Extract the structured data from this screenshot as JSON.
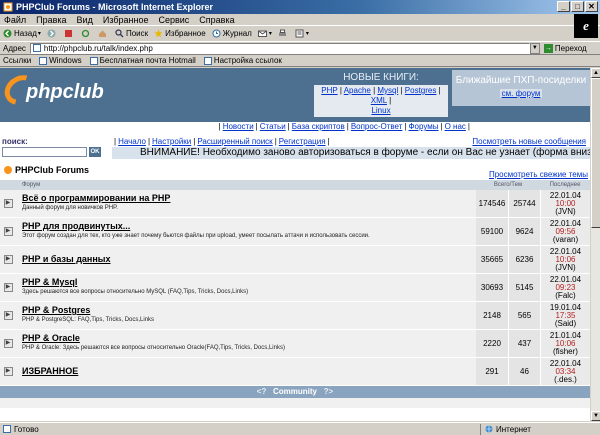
{
  "window": {
    "title": "PHPClub Forums - Microsoft Internet Explorer",
    "min": "_",
    "max": "□",
    "close": "✕"
  },
  "menu": [
    "Файл",
    "Правка",
    "Вид",
    "Избранное",
    "Сервис",
    "Справка"
  ],
  "toolbar": {
    "back": "Назад",
    "search": "Поиск",
    "favorites": "Избранное",
    "history": "Журнал"
  },
  "address": {
    "label": "Адрес",
    "url": "http://phpclub.ru/talk/index.php",
    "go": "Переход"
  },
  "links": {
    "label": "Ссылки",
    "items": [
      "Windows",
      "Бесплатная почта Hotmail",
      "Настройка ссылок"
    ]
  },
  "site": {
    "logo": "phpclub",
    "books_title": "НОВЫЕ КНИГИ:",
    "books_links": [
      "PHP",
      "Apache",
      "Mysql",
      "Postgres",
      "XML",
      "Linux"
    ],
    "meetup_title": "Ближайшие ПХП-посиделки",
    "meetup_link": "см. форум",
    "top_nav": [
      "Новости",
      "Статьи",
      "База скриптов",
      "Вопрос-Ответ",
      "Форумы",
      "О нас"
    ],
    "search_label": "поиск:",
    "search_ok": "OK",
    "sub_nav": [
      "Начало",
      "Настройки",
      "Расширенный поиск",
      "Регистрация"
    ],
    "new_messages": "Посмотреть новые сообщения",
    "alert": "ВНИМАНИЕ! Необходимо заново авторизоваться в форуме - если он Вас не узнает (форма внизу)",
    "forums_title": "PHPClub Forums",
    "fresh_topics": "Просмотреть свежие темы"
  },
  "table": {
    "headers": {
      "forum": "Форум",
      "totals": "Всего/Тем",
      "last": "Последнее"
    },
    "rows": [
      {
        "title": "Всё о программировании на PHP",
        "desc": "Данный форум для новичков PHP.",
        "posts": "174546",
        "topics": "25744",
        "date": "22.01.04",
        "time": "10:00",
        "user": "(JVN)"
      },
      {
        "title": "PHP для продвинутых...",
        "desc": "Этот форум создан для тех, кто уже знает почему бьются файлы при upload, умеет посылать аттачи и использовать сессии.",
        "posts": "59100",
        "topics": "9624",
        "date": "22.01.04",
        "time": "09:56",
        "user": "(varan)"
      },
      {
        "title": "PHP и базы данных",
        "desc": "",
        "posts": "35665",
        "topics": "6236",
        "date": "22.01.04",
        "time": "10:06",
        "user": "(JVN)"
      },
      {
        "title": "PHP & Mysql",
        "desc": "Здесь решаются все вопросы относительно MySQL (FAQ,Tips, Tricks, Docs,Links)",
        "posts": "30693",
        "topics": "5145",
        "date": "22.01.04",
        "time": "09:23",
        "user": "(Falc)"
      },
      {
        "title": "PHP & Postgres",
        "desc": "PHP & PostgreSQL: FAQ,Tips, Tricks, Docs,Links",
        "posts": "2148",
        "topics": "565",
        "date": "19.01.04",
        "time": "17:35",
        "user": "(Said)"
      },
      {
        "title": "PHP & Oracle",
        "desc": "PHP & Oracle: Здесь решаются все вопросы относительно Oracle(FAQ,Tips, Tricks, Docs,Links)",
        "posts": "2220",
        "topics": "437",
        "date": "21.01.04",
        "time": "10:06",
        "user": "(fisher)"
      },
      {
        "title": "ИЗБРАННОЕ",
        "desc": "",
        "posts": "291",
        "topics": "46",
        "date": "22.01.04",
        "time": "03:34",
        "user": "(.des.)"
      }
    ],
    "community": {
      "prev": "<?",
      "label": "Community",
      "next": "?>"
    }
  },
  "status": {
    "left": "Готово",
    "right": "Интернет"
  }
}
